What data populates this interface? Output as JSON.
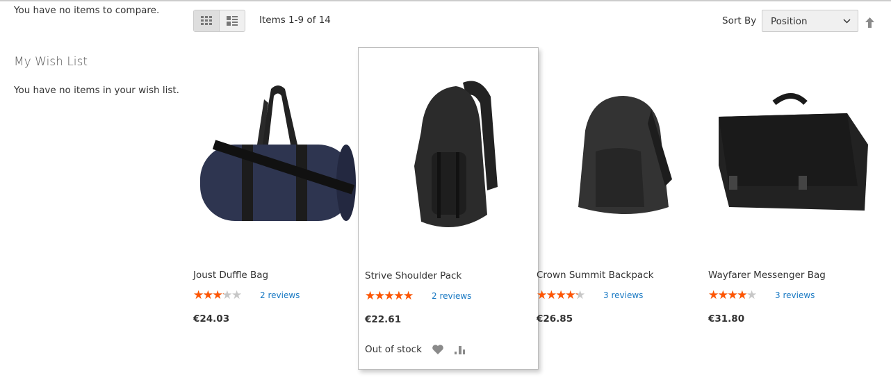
{
  "sidebar": {
    "compare_empty": "You have no items to compare.",
    "wishlist_title": "My Wish List",
    "wishlist_empty": "You have no items in your wish list."
  },
  "toolbar": {
    "modes": [
      {
        "icon": "grid-icon",
        "active": true
      },
      {
        "icon": "list-icon",
        "active": false
      }
    ],
    "amount": "Items 1-9 of 14",
    "sort_label": "Sort By",
    "sort_value": "Position",
    "sort_dir_icon": "arrow-up-icon"
  },
  "products": [
    {
      "name": "Joust Duffle Bag",
      "rating_percent": 50,
      "reviews": "2 reviews",
      "price": "€24.03"
    },
    {
      "name": "Strive Shoulder Pack",
      "rating_percent": 90,
      "reviews": "2 reviews",
      "price": "€22.61",
      "stock": "Out of stock"
    },
    {
      "name": "Crown Summit Backpack",
      "rating_percent": 67,
      "reviews": "3 reviews",
      "price": "€26.85"
    },
    {
      "name": "Wayfarer Messenger Bag",
      "rating_percent": 64,
      "reviews": "3 reviews",
      "price": "€31.80"
    }
  ],
  "colors": {
    "star": "#ff5501",
    "link": "#1979c3"
  }
}
